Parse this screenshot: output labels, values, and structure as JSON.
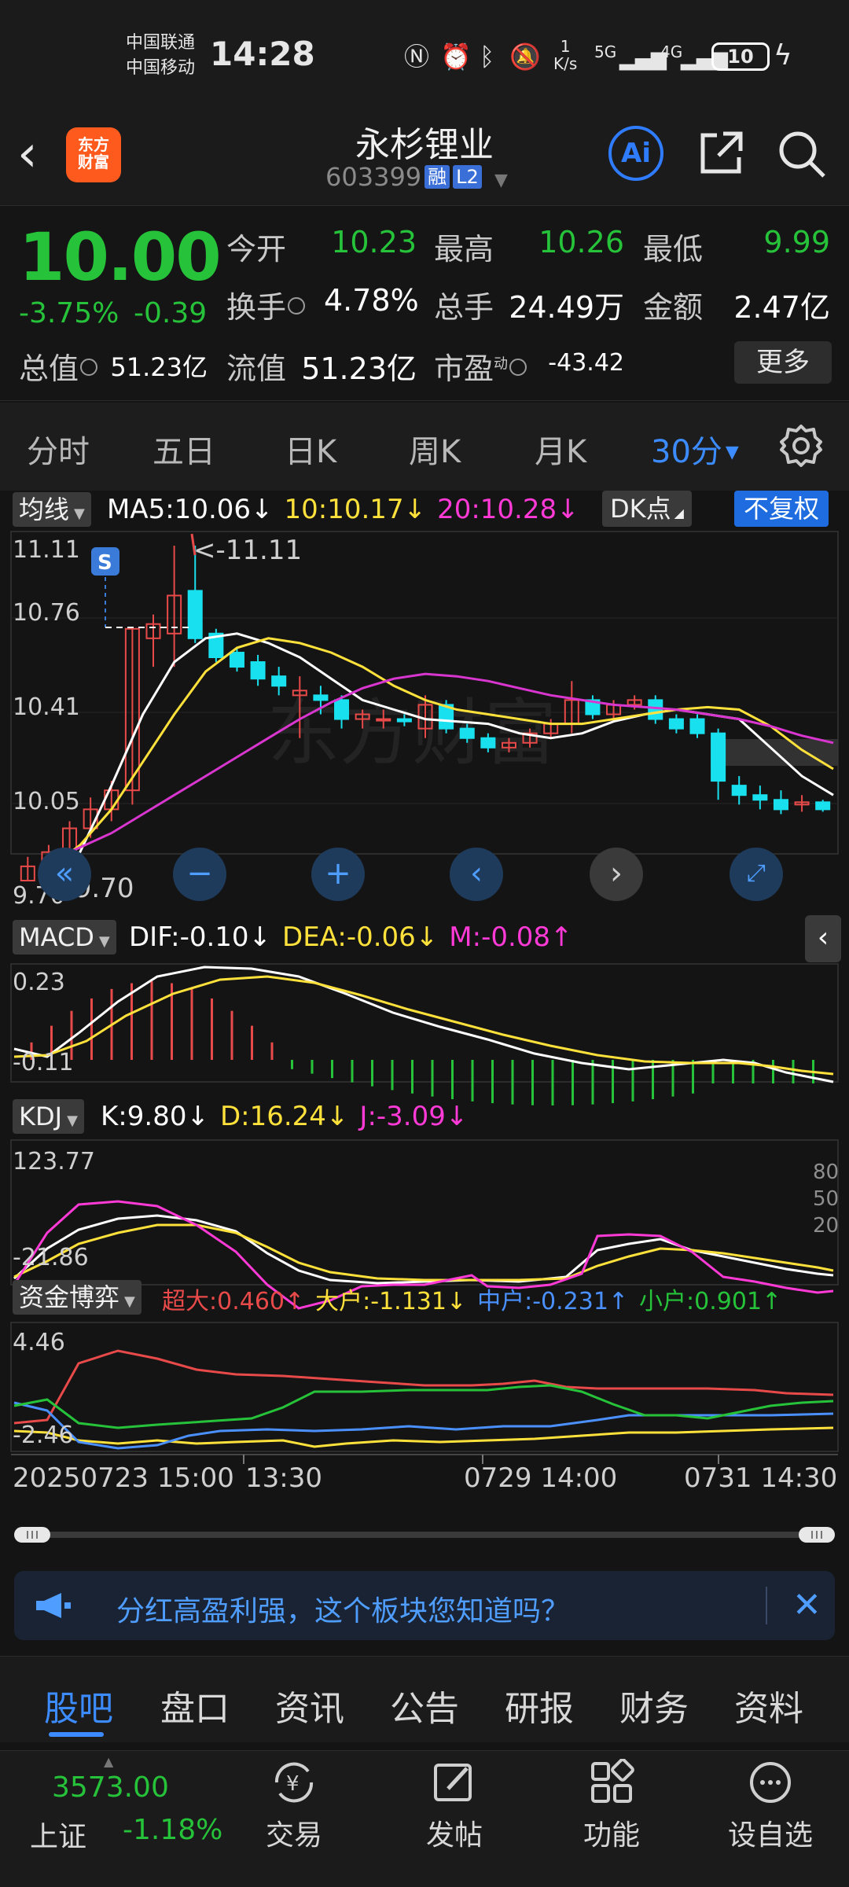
{
  "status_bar": {
    "carrier1": "中国联通",
    "carrier2": "中国移动",
    "time": "14:28",
    "net_speed_value": "1",
    "net_speed_unit": "K/s",
    "signal1": "5G",
    "signal2": "4G",
    "battery": "10"
  },
  "header": {
    "logo_line1": "东方",
    "logo_line2": "财富",
    "stock_name": "永杉锂业",
    "stock_code": "603399",
    "tag_margin": "融",
    "tag_level": "L2",
    "ai_label": "Ai"
  },
  "quote": {
    "price": "10.00",
    "change_pct": "-3.75%",
    "change_abs": "-0.39",
    "open_label": "今开",
    "open_value": "10.23",
    "high_label": "最高",
    "high_value": "10.26",
    "low_label": "最低",
    "low_value": "9.99",
    "turnover_label": "换手",
    "turnover_value": "4.78%",
    "volume_label": "总手",
    "volume_value": "24.49万",
    "amount_label": "金额",
    "amount_value": "2.47亿",
    "mktcap_label": "总值",
    "mktcap_value": "51.23亿",
    "float_label": "流值",
    "float_value": "51.23亿",
    "pe_label": "市盈",
    "pe_sup": "动",
    "pe_value": "-43.42",
    "more_label": "更多"
  },
  "period_tabs": [
    "分时",
    "五日",
    "日K",
    "周K",
    "月K",
    "30分"
  ],
  "active_period": "30分",
  "chart": {
    "ma_selector": "均线",
    "ma5": "MA5:10.06↓",
    "ma10": "10:10.17↓",
    "ma20": "20:10.28↓",
    "dk_label": "DK点",
    "fq_label": "不复权",
    "s_marker": "S",
    "high_annot": "<-11.11",
    "low_annot": "<-9.70",
    "watermark": "东方财富",
    "y_ticks": [
      "11.11",
      "10.76",
      "10.41",
      "10.05",
      "9.70"
    ],
    "macd_selector": "MACD",
    "dif": "DIF:-0.10↓",
    "dea": "DEA:-0.06↓",
    "macd_m": "M:-0.08↑",
    "macd_top": "0.23",
    "macd_bottom": "-0.11",
    "kdj_selector": "KDJ",
    "kdj_k": "K:9.80↓",
    "kdj_d": "D:16.24↓",
    "kdj_j": "J:-3.09↓",
    "kdj_top": "123.77",
    "kdj_bottom": "-21.86",
    "kdj_80": "80",
    "kdj_50": "50",
    "kdj_20": "20",
    "fund_selector": "资金博弈",
    "fund_super": "超大:0.460↑",
    "fund_large": "大户:-1.131↓",
    "fund_mid": "中户:-0.231↑",
    "fund_small": "小户:0.901↑",
    "fund_top": "4.46",
    "fund_bottom": "-2.46",
    "x_axis": [
      "20250723 15:00",
      "13:30",
      "0729 14:00",
      "0731 14:30"
    ]
  },
  "chart_data": {
    "type": "candlestick",
    "title": "",
    "ylim": [
      9.7,
      11.11
    ],
    "candles_ohlc": [
      [
        9.7,
        9.8,
        9.7,
        9.76
      ],
      [
        9.76,
        9.85,
        9.72,
        9.82
      ],
      [
        9.82,
        9.95,
        9.78,
        9.92
      ],
      [
        9.92,
        10.05,
        9.88,
        10.0
      ],
      [
        10.0,
        10.12,
        9.95,
        10.08
      ],
      [
        10.08,
        10.76,
        10.02,
        10.76
      ],
      [
        10.72,
        10.82,
        10.6,
        10.78
      ],
      [
        10.74,
        11.11,
        10.6,
        10.9
      ],
      [
        10.92,
        11.11,
        10.7,
        10.72
      ],
      [
        10.74,
        10.76,
        10.62,
        10.64
      ],
      [
        10.66,
        10.68,
        10.58,
        10.6
      ],
      [
        10.62,
        10.65,
        10.52,
        10.55
      ],
      [
        10.56,
        10.6,
        10.48,
        10.52
      ],
      [
        10.48,
        10.56,
        10.3,
        10.5
      ],
      [
        10.48,
        10.52,
        10.4,
        10.46
      ],
      [
        10.46,
        10.48,
        10.34,
        10.38
      ],
      [
        10.38,
        10.42,
        10.34,
        10.4
      ],
      [
        10.38,
        10.42,
        10.34,
        10.38
      ],
      [
        10.38,
        10.4,
        10.35,
        10.37
      ],
      [
        10.34,
        10.48,
        10.3,
        10.44
      ],
      [
        10.44,
        10.46,
        10.32,
        10.34
      ],
      [
        10.34,
        10.36,
        10.28,
        10.3
      ],
      [
        10.3,
        10.32,
        10.24,
        10.26
      ],
      [
        10.26,
        10.3,
        10.24,
        10.28
      ],
      [
        10.28,
        10.34,
        10.26,
        10.32
      ],
      [
        10.32,
        10.38,
        10.3,
        10.36
      ],
      [
        10.36,
        10.54,
        10.32,
        10.46
      ],
      [
        10.46,
        10.48,
        10.38,
        10.4
      ],
      [
        10.4,
        10.46,
        10.38,
        10.44
      ],
      [
        10.44,
        10.48,
        10.42,
        10.46
      ],
      [
        10.46,
        10.48,
        10.36,
        10.38
      ],
      [
        10.38,
        10.4,
        10.32,
        10.34
      ],
      [
        10.38,
        10.4,
        10.3,
        10.32
      ],
      [
        10.32,
        10.34,
        10.04,
        10.12
      ],
      [
        10.1,
        10.14,
        10.02,
        10.06
      ],
      [
        10.06,
        10.1,
        10.0,
        10.04
      ],
      [
        10.04,
        10.08,
        9.98,
        10.0
      ],
      [
        10.02,
        10.06,
        9.99,
        10.03
      ],
      [
        10.03,
        10.04,
        9.99,
        10.0
      ]
    ],
    "series": [
      {
        "name": "MA5",
        "values": [
          9.72,
          9.82,
          10.1,
          10.4,
          10.62,
          10.72,
          10.74,
          10.7,
          10.64,
          10.55,
          10.46,
          10.42,
          10.38,
          10.37,
          10.36,
          10.32,
          10.3,
          10.32,
          10.37,
          10.4,
          10.42,
          10.4,
          10.38,
          10.26,
          10.14,
          10.06
        ]
      },
      {
        "name": "MA10",
        "values": [
          9.75,
          9.85,
          10.0,
          10.2,
          10.4,
          10.58,
          10.68,
          10.72,
          10.7,
          10.66,
          10.6,
          10.52,
          10.46,
          10.42,
          10.4,
          10.38,
          10.36,
          10.36,
          10.38,
          10.4,
          10.42,
          10.43,
          10.42,
          10.35,
          10.25,
          10.17
        ]
      },
      {
        "name": "MA20",
        "values": [
          9.78,
          9.84,
          9.9,
          9.98,
          10.06,
          10.14,
          10.22,
          10.3,
          10.38,
          10.45,
          10.51,
          10.55,
          10.57,
          10.56,
          10.54,
          10.51,
          10.48,
          10.46,
          10.44,
          10.43,
          10.42,
          10.4,
          10.38,
          10.35,
          10.31,
          10.28
        ]
      }
    ]
  },
  "promo": {
    "text": "分红高盈利强，这个板块您知道吗？"
  },
  "content_tabs": [
    "股吧",
    "盘口",
    "资讯",
    "公告",
    "研报",
    "财务",
    "资料"
  ],
  "active_content_tab": "股吧",
  "bottom_bar": {
    "index_value": "3573.00",
    "index_name": "上证",
    "index_change": "-1.18%",
    "trade_label": "交易",
    "post_label": "发帖",
    "func_label": "功能",
    "watch_label": "设自选"
  },
  "colors": {
    "up": "#e84a4a",
    "down": "#26c33a",
    "accent": "#3c8cff",
    "ma5": "#ffffff",
    "ma10": "#ffe13b",
    "ma20": "#d936d0"
  }
}
